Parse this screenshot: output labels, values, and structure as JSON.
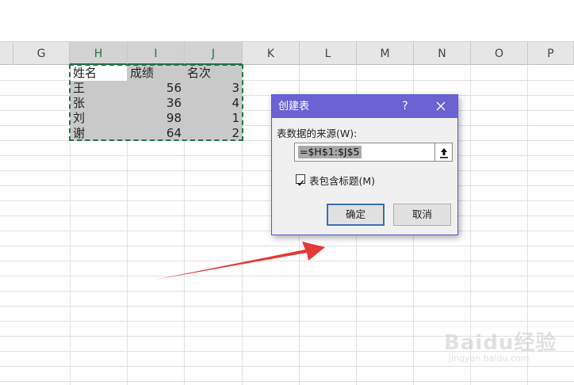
{
  "columns": [
    {
      "label": "G",
      "selected": false
    },
    {
      "label": "H",
      "selected": true
    },
    {
      "label": "I",
      "selected": true
    },
    {
      "label": "J",
      "selected": true
    },
    {
      "label": "K",
      "selected": false
    },
    {
      "label": "L",
      "selected": false
    },
    {
      "label": "M",
      "selected": false
    },
    {
      "label": "N",
      "selected": false
    },
    {
      "label": "O",
      "selected": false
    },
    {
      "label": "P",
      "selected": false
    }
  ],
  "table": {
    "header": [
      "姓名",
      "成绩",
      "名次"
    ],
    "rows": [
      [
        "王",
        "56",
        "3"
      ],
      [
        "张",
        "36",
        "4"
      ],
      [
        "刘",
        "98",
        "1"
      ],
      [
        "谢",
        "64",
        "2"
      ]
    ]
  },
  "dialog": {
    "title": "创建表",
    "help": "?",
    "source_label": "表数据的来源(W):",
    "range_value": "=$H$1:$J$5",
    "has_headers_label": "表包含标题(M)",
    "has_headers_checked": true,
    "ok_label": "确定",
    "cancel_label": "取消"
  },
  "watermark": {
    "brand": "Baidu经验",
    "url": "jingyan.baidu.com"
  },
  "colors": {
    "selection_border": "#217346",
    "dialog_titlebar": "#6b63d4",
    "arrow": "#e53935"
  }
}
